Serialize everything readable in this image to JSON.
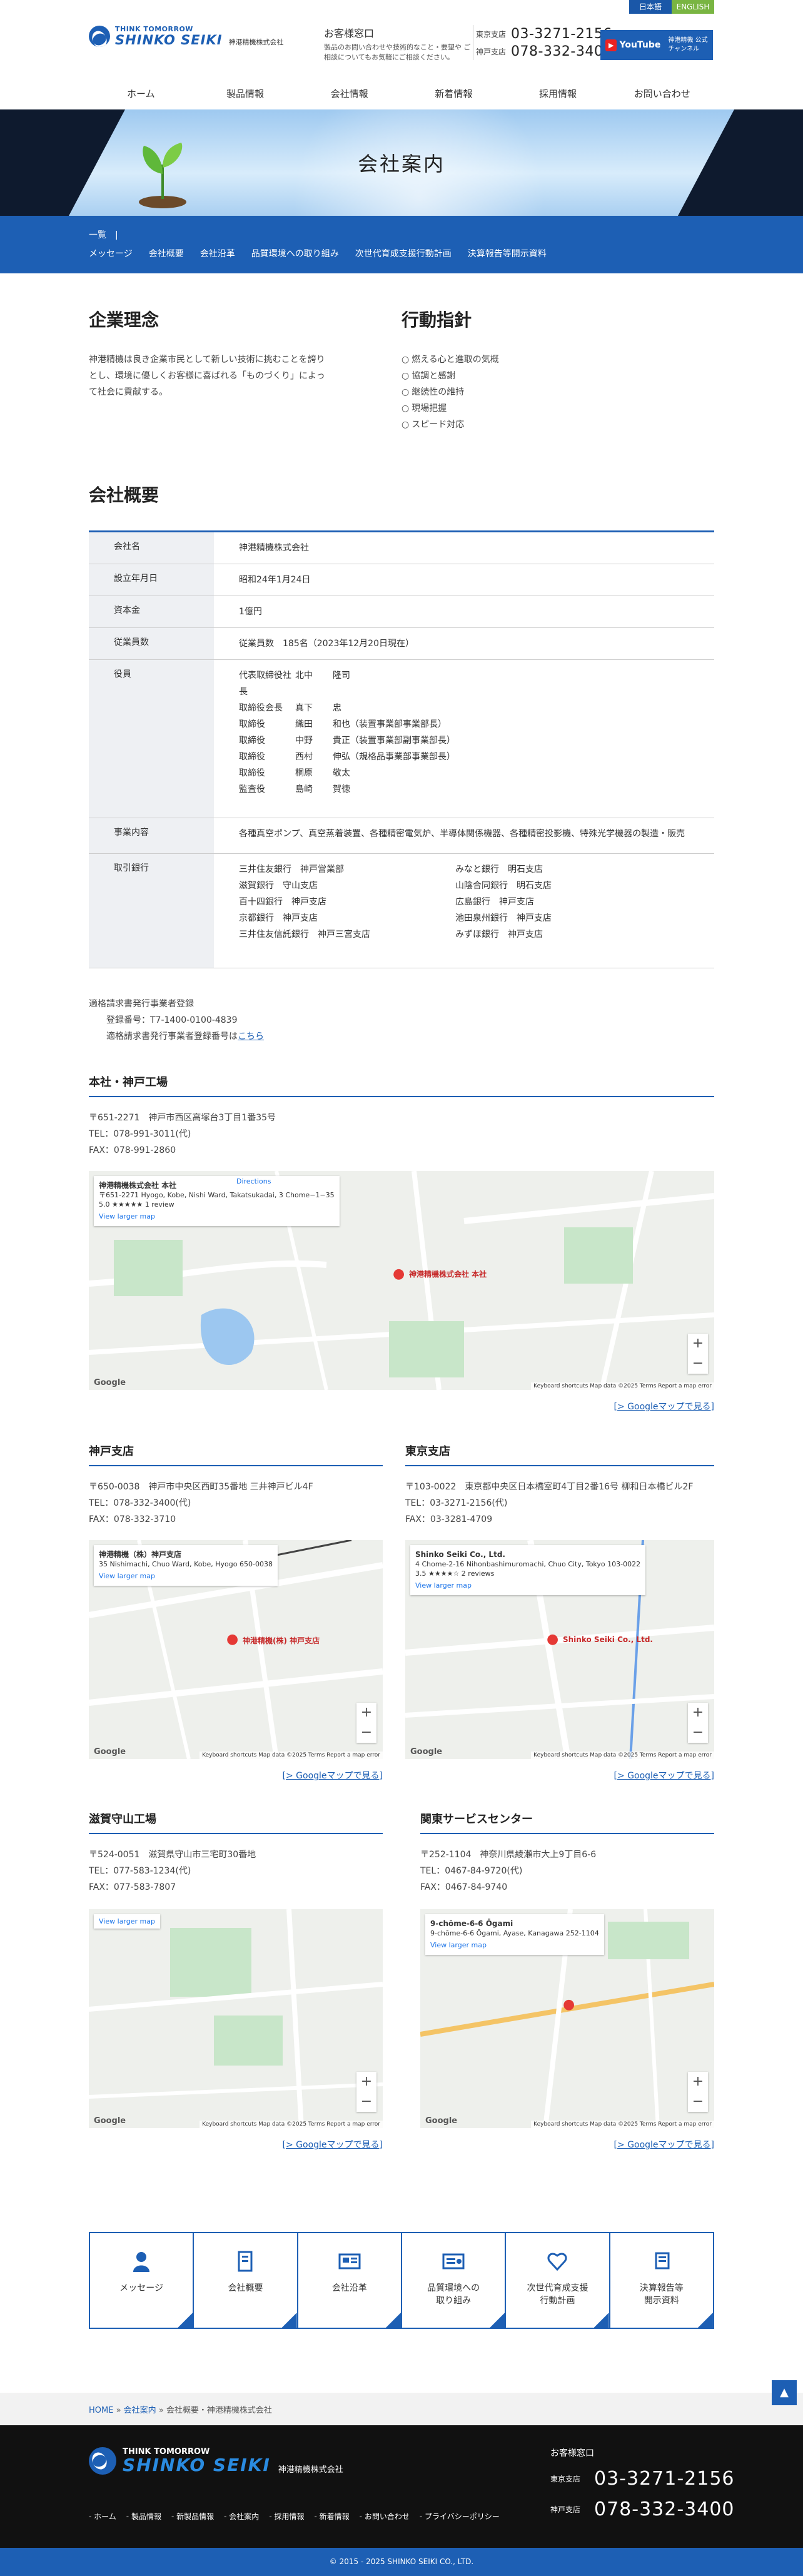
{
  "lang": {
    "ja": "日本語",
    "en": "ENGLISH"
  },
  "header": {
    "tagline": "THINK TOMORROW",
    "logo": "SHINKO SEIKI",
    "company": "神港精機株式会社",
    "contact_title": "お客様窓口",
    "contact_desc": "製品のお問い合わせや技術的なこと・要望や ご相談についてもお気軽にご相談ください。",
    "tokyo_label": "東京支店",
    "tokyo_phone": "03-3271-2156",
    "kobe_label": "神戸支店",
    "kobe_phone": "078-332-3400",
    "youtube_badge": "▶",
    "youtube_label": "YouTube",
    "youtube_text": "神港精機 公式チャンネル"
  },
  "nav": [
    "ホーム",
    "製品情報",
    "会社情報",
    "新着情報",
    "採用情報",
    "お問い合わせ"
  ],
  "hero": {
    "title": "会社案内"
  },
  "subnav": {
    "top": "一覧　|",
    "items": [
      "メッセージ",
      "会社概要",
      "会社沿革",
      "品質環境への取り組み",
      "次世代育成支援行動計画",
      "決算報告等開示資料"
    ]
  },
  "philosophy": {
    "title": "企業理念",
    "text": "神港精機は良き企業市民として新しい技術に挑むことを誇りとし、環境に優しくお客様に喜ばれる「ものづくり」によって社会に貢献する。"
  },
  "conduct": {
    "title": "行動指針",
    "items": [
      "燃える心と進取の気概",
      "協調と感謝",
      "継続性の維持",
      "現場把握",
      "スピード対応"
    ]
  },
  "overview": {
    "title": "会社概要",
    "rows": [
      {
        "k": "会社名",
        "v": "神港精機株式会社"
      },
      {
        "k": "設立年月日",
        "v": "昭和24年1月24日"
      },
      {
        "k": "資本金",
        "v": "1億円"
      },
      {
        "k": "従業員数",
        "v": "従業員数　185名（2023年12月20日現在）"
      },
      {
        "k": "事業内容",
        "v": "各種真空ポンプ、真空蒸着装置、各種精密電気炉、半導体関係機器、各種精密投影機、特殊光学機器の製造・販売"
      },
      {
        "k": "取引銀行",
        "v": ""
      }
    ],
    "officers_label": "役員",
    "officers": [
      [
        "代表取締役社長",
        "北中",
        "隆司"
      ],
      [
        "取締役会長",
        "真下",
        "忠"
      ],
      [
        "取締役",
        "織田",
        "和也（装置事業部事業部長）"
      ],
      [
        "取締役",
        "中野",
        "貴正（装置事業部副事業部長）"
      ],
      [
        "取締役",
        "西村",
        "伸弘（規格品事業部事業部長）"
      ],
      [
        "取締役",
        "桐原",
        "敬太"
      ],
      [
        "監査役",
        "島崎",
        "賀徳"
      ]
    ],
    "banks": [
      "三井住友銀行　神戸営業部",
      "みなと銀行　明石支店",
      "滋賀銀行　守山支店",
      "山陰合同銀行　明石支店",
      "百十四銀行　神戸支店",
      "広島銀行　神戸支店",
      "京都銀行　神戸支店",
      "池田泉州銀行　神戸支店",
      "三井住友信託銀行　神戸三宮支店",
      "みずほ銀行　神戸支店"
    ]
  },
  "invoice": {
    "title": "適格請求書発行事業者登録",
    "number": "登録番号：T7-1400-0100-4839",
    "note": "適格請求書発行事業者登録番号は",
    "link": "こちら"
  },
  "sites": {
    "hq": {
      "title": "本社・神戸工場",
      "addr": "〒651-2271　神戸市西区高塚台3丁目1番35号",
      "tel": "TEL：078-991-3011(代)",
      "fax": "FAX：078-991-2860",
      "map_name": "神港精機株式会社 本社",
      "map_addr": "〒651-2271 Hyogo, Kobe, Nishi Ward, Takatsukadai, 3 Chome−1−35",
      "map_rating": "5.0 ★★★★★  1 review",
      "map_view": "View larger map",
      "map_dir": "Directions",
      "map_pin": "神港精機株式会社 本社"
    },
    "kobe": {
      "title": "神戸支店",
      "addr": "〒650-0038　神戸市中央区西町35番地 三井神戸ビル4F",
      "tel": "TEL：078-332-3400(代)",
      "fax": "FAX：078-332-3710",
      "map_name": "神港精機（株）神戸支店",
      "map_addr": "35 Nishimachi, Chuo Ward, Kobe, Hyogo 650-0038",
      "map_view": "View larger map",
      "map_pin": "神港精機(株) 神戸支店"
    },
    "tokyo": {
      "title": "東京支店",
      "addr": "〒103-0022　東京都中央区日本橋室町4丁目2番16号 柳和日本橋ビル2F",
      "tel": "TEL：03-3271-2156(代)",
      "fax": "FAX：03-3281-4709",
      "map_name": "Shinko Seiki Co., Ltd.",
      "map_addr": "4 Chome-2-16 Nihonbashimuromachi, Chuo City, Tokyo 103-0022",
      "map_rating": "3.5 ★★★★☆  2 reviews",
      "map_view": "View larger map",
      "map_pin": "Shinko Seiki Co., Ltd."
    },
    "shiga": {
      "title": "滋賀守山工場",
      "addr": "〒524-0051　滋賀県守山市三宅町30番地",
      "tel": "TEL：077-583-1234(代)",
      "fax": "FAX：077-583-7807",
      "map_name": "",
      "map_view": "View larger map"
    },
    "kanto": {
      "title": "関東サービスセンター",
      "addr": "〒252-1104　神奈川県綾瀬市大上9丁目6-6",
      "tel": "TEL：0467-84-9720(代)",
      "fax": "FAX：0467-84-9740",
      "map_name": "9-chōme-6-6 Ōgami",
      "map_addr": "9-chōme-6-6 Ōgami, Ayase, Kanagawa 252-1104",
      "map_view": "View larger map"
    }
  },
  "map_link": "[> Googleマップで見る]",
  "map_footer": "Keyboard shortcuts   Map data ©2025   Terms   Report a map error",
  "google": "Google",
  "cards": [
    "メッセージ",
    "会社概要",
    "会社沿革",
    "品質環境への\n取り組み",
    "次世代育成支援\n行動計画",
    "決算報告等\n開示資料"
  ],
  "breadcrumb": {
    "home": "HOME",
    "sep1": " » ",
    "company": "会社案内",
    "sep2": " » ",
    "current": "会社概要・神港精機株式会社"
  },
  "footer": {
    "tagline": "THINK TOMORROW",
    "logo": "SHINKO SEIKI",
    "company": "神港精機株式会社",
    "nav": [
      "ホーム",
      "製品情報",
      "新製品情報",
      "会社案内",
      "採用情報",
      "新着情報",
      "お問い合わせ",
      "プライバシーポリシー"
    ],
    "contact_title": "お客様窓口",
    "tokyo_label": "東京支店",
    "tokyo_phone": "03-3271-2156",
    "kobe_label": "神戸支店",
    "kobe_phone": "078-332-3400"
  },
  "copyright": "© 2015 - 2025 SHINKO SEIKI CO., LTD."
}
